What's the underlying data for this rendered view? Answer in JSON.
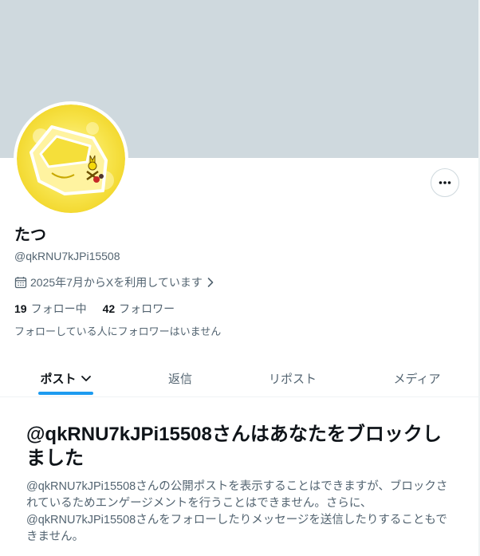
{
  "profile": {
    "name": "たつ",
    "handle": "@qkRNU7kJPi15508",
    "joined": "2025年7月からXを利用しています",
    "following_count": "19",
    "following_label": "フォロー中",
    "followers_count": "42",
    "followers_label": "フォロワー",
    "no_common_followers": "フォローしている人にフォロワーはいません"
  },
  "tabs": [
    {
      "label": "ポスト",
      "active": true
    },
    {
      "label": "返信",
      "active": false
    },
    {
      "label": "リポスト",
      "active": false
    },
    {
      "label": "メディア",
      "active": false
    }
  ],
  "blocked": {
    "title": "@qkRNU7kJPi15508さんはあなたをブロックしました",
    "body": "@qkRNU7kJPi15508さんの公開ポストを表示することはできますが、ブロックされているためエンゲージメントを行うことはできません。さらに、@qkRNU7kJPi15508さんをフォローしたりメッセージを送信したりすることもできません。"
  },
  "icons": {
    "more": "more-horizontal-icon",
    "calendar": "calendar-icon",
    "chevron_right": "chevron-right-icon",
    "chevron_down": "chevron-down-icon"
  },
  "colors": {
    "banner": "#cfd9de",
    "accent": "#1d9bf0",
    "secondary_text": "#536471",
    "primary_text": "#0f1419"
  }
}
